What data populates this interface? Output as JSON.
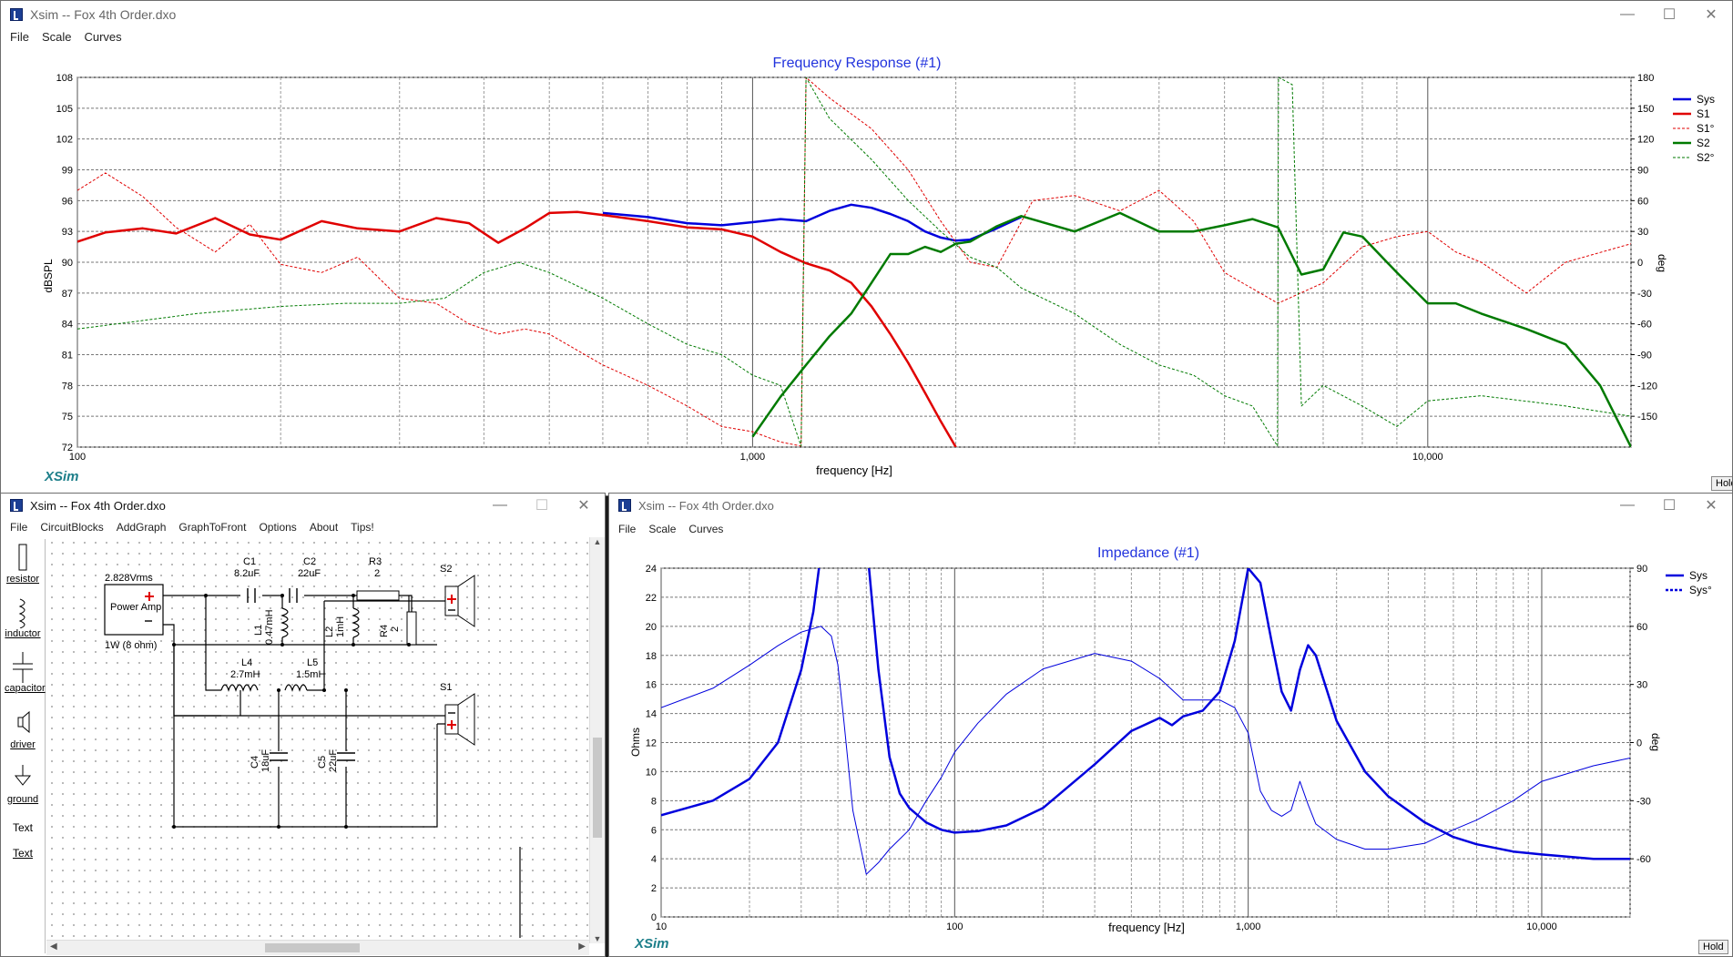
{
  "main_window": {
    "title": "Xsim -- Fox 4th Order.dxo",
    "menu": [
      "File",
      "Scale",
      "Curves"
    ],
    "hold_label": "Hold",
    "brand": "XSim"
  },
  "fr_chart": {
    "title": "Frequency Response (#1)",
    "xlabel": "frequency [Hz]",
    "ylabel": "dBSPL",
    "y2label": "deg",
    "x_ticks": [
      "100",
      "1,000",
      "10,000"
    ],
    "y_ticks": [
      "108",
      "105",
      "102",
      "99",
      "96",
      "93",
      "90",
      "87",
      "84",
      "81",
      "78",
      "75",
      "72"
    ],
    "y2_ticks": [
      "180",
      "150",
      "120",
      "90",
      "60",
      "30",
      "0",
      "-30",
      "-60",
      "-90",
      "-120",
      "-150"
    ],
    "legend": [
      "Sys",
      "S1",
      "S1°",
      "S2",
      "S2°"
    ],
    "colors": {
      "sys": "#0000dd",
      "s1": "#e00000",
      "s2": "#007a00"
    }
  },
  "chart_data": [
    {
      "type": "line",
      "title": "Frequency Response (#1)",
      "xlabel": "frequency [Hz]",
      "ylabel": "dBSPL",
      "y2label": "deg",
      "xscale": "log",
      "xlim": [
        100,
        20000
      ],
      "ylim": [
        72,
        108
      ],
      "y2lim": [
        -180,
        180
      ],
      "grid": true,
      "legend": "right",
      "series": [
        {
          "name": "Sys",
          "axis": "left",
          "style": "solid",
          "color": "#0000dd",
          "x": [
            600,
            700,
            800,
            900,
            1000,
            1100,
            1200,
            1300,
            1400,
            1500,
            1600,
            1700,
            1800,
            1900,
            2000,
            2100,
            2300,
            2500
          ],
          "y": [
            94.8,
            94.4,
            93.8,
            93.6,
            93.9,
            94.2,
            94.0,
            95.0,
            95.6,
            95.3,
            94.7,
            94.0,
            93.0,
            92.4,
            92.1,
            92.2,
            93.3,
            94.4
          ]
        },
        {
          "name": "S1",
          "axis": "left",
          "style": "solid",
          "color": "#e00000",
          "x": [
            100,
            110,
            125,
            140,
            160,
            180,
            200,
            230,
            260,
            300,
            340,
            380,
            420,
            460,
            500,
            550,
            600,
            700,
            800,
            900,
            1000,
            1100,
            1200,
            1300,
            1400,
            1500,
            1600,
            1700,
            1800,
            1900,
            2000
          ],
          "y": [
            92.0,
            92.9,
            93.3,
            92.8,
            94.3,
            92.7,
            92.2,
            94.0,
            93.3,
            93.0,
            94.3,
            93.8,
            91.9,
            93.3,
            94.8,
            94.9,
            94.6,
            94.0,
            93.4,
            93.2,
            92.5,
            91.0,
            89.9,
            89.2,
            88.0,
            85.7,
            83.0,
            80.2,
            77.3,
            74.5,
            72.0
          ]
        },
        {
          "name": "S1°",
          "axis": "right",
          "style": "dashed",
          "color": "#e00000",
          "x": [
            100,
            110,
            125,
            140,
            160,
            180,
            200,
            230,
            260,
            300,
            340,
            380,
            420,
            460,
            500,
            600,
            700,
            800,
            900,
            1000,
            1100,
            1180,
            1200,
            1300,
            1500,
            1700,
            1900,
            2100,
            2300,
            2600,
            3000,
            3500,
            4000,
            4500,
            5000,
            6000,
            7000,
            8000,
            9000,
            10000,
            11000,
            12000,
            14000,
            16000,
            20000
          ],
          "y": [
            70,
            87,
            64,
            34,
            10,
            37,
            -2,
            -10,
            5,
            -35,
            -40,
            -60,
            -70,
            -65,
            -70,
            -100,
            -120,
            -140,
            -160,
            -165,
            -175,
            -179,
            180,
            160,
            130,
            90,
            40,
            0,
            -5,
            60,
            65,
            50,
            70,
            40,
            -10,
            -40,
            -20,
            15,
            25,
            30,
            10,
            0,
            -30,
            0,
            18
          ]
        },
        {
          "name": "S2",
          "axis": "left",
          "style": "solid",
          "color": "#007a00",
          "x": [
            1000,
            1100,
            1200,
            1300,
            1400,
            1500,
            1600,
            1700,
            1800,
            1900,
            2000,
            2100,
            2300,
            2500,
            3000,
            3500,
            4000,
            4500,
            5000,
            5500,
            6000,
            6500,
            7000,
            7500,
            8000,
            9000,
            10000,
            11000,
            12000,
            14000,
            16000,
            18000,
            20000
          ],
          "y": [
            73.0,
            76.9,
            80.0,
            82.8,
            85.0,
            88.0,
            90.8,
            90.8,
            91.5,
            91.0,
            91.8,
            92.0,
            93.5,
            94.5,
            93.0,
            94.8,
            93.0,
            93.0,
            93.6,
            94.2,
            93.4,
            88.8,
            89.3,
            92.9,
            92.5,
            89.0,
            86.0,
            86.0,
            85.0,
            83.5,
            82.0,
            78.0,
            72.0
          ]
        },
        {
          "name": "S2°",
          "axis": "right",
          "style": "dashed",
          "color": "#007a00",
          "x": [
            100,
            150,
            200,
            250,
            300,
            350,
            400,
            450,
            500,
            600,
            700,
            800,
            900,
            1000,
            1100,
            1180,
            1200,
            1300,
            1500,
            1700,
            1900,
            2100,
            2300,
            2500,
            3000,
            3500,
            4000,
            4500,
            5000,
            5500,
            5990,
            6010,
            6300,
            6500,
            7000,
            8000,
            9000,
            10000,
            12000,
            16000,
            20000
          ],
          "y": [
            -65,
            -50,
            -43,
            -40,
            -40,
            -35,
            -10,
            0,
            -10,
            -35,
            -60,
            -80,
            -90,
            -110,
            -120,
            -179,
            180,
            140,
            100,
            60,
            30,
            5,
            -5,
            -25,
            -50,
            -80,
            -100,
            -110,
            -130,
            -140,
            -179,
            180,
            173,
            -140,
            -120,
            -140,
            -160,
            -135,
            -130,
            -140,
            -150
          ]
        }
      ]
    },
    {
      "type": "line",
      "title": "Impedance (#1)",
      "xlabel": "frequency [Hz]",
      "ylabel": "Ohms",
      "y2label": "deg",
      "xscale": "log",
      "xlim": [
        10,
        20000
      ],
      "ylim": [
        0,
        24
      ],
      "y2lim": [
        -90,
        90
      ],
      "grid": true,
      "legend": "right",
      "series": [
        {
          "name": "Sys",
          "axis": "left",
          "style": "solid",
          "color": "#0000dd",
          "x": [
            10,
            15,
            20,
            25,
            30,
            33,
            35,
            40,
            45,
            50,
            55,
            60,
            65,
            70,
            80,
            90,
            100,
            120,
            150,
            200,
            300,
            400,
            500,
            550,
            600,
            700,
            800,
            900,
            1000,
            1100,
            1200,
            1300,
            1400,
            1500,
            1600,
            1700,
            2000,
            2500,
            3000,
            4000,
            5000,
            6000,
            8000,
            10000,
            15000,
            20000
          ],
          "y": [
            7.0,
            8.0,
            9.5,
            12.0,
            17.0,
            21.0,
            25.0,
            30.0,
            30.0,
            26.0,
            17.0,
            11.0,
            8.5,
            7.5,
            6.5,
            6.0,
            5.8,
            5.9,
            6.3,
            7.5,
            10.5,
            12.8,
            13.7,
            13.2,
            13.8,
            14.2,
            15.5,
            19.0,
            24.0,
            23.0,
            19.0,
            15.5,
            14.2,
            17.0,
            18.7,
            18.0,
            13.5,
            10.0,
            8.3,
            6.5,
            5.5,
            5.0,
            4.5,
            4.3,
            4.0,
            4.0
          ]
        },
        {
          "name": "Sys°",
          "axis": "right",
          "style": "solid",
          "color": "#0000dd",
          "x": [
            10,
            15,
            20,
            25,
            30,
            35,
            38,
            40,
            42,
            45,
            50,
            55,
            60,
            70,
            80,
            90,
            100,
            120,
            150,
            200,
            300,
            400,
            500,
            600,
            700,
            800,
            900,
            1000,
            1100,
            1200,
            1300,
            1400,
            1500,
            1600,
            1700,
            2000,
            2500,
            3000,
            4000,
            5000,
            6000,
            8000,
            10000,
            15000,
            20000
          ],
          "y": [
            18,
            28,
            40,
            50,
            57,
            60,
            55,
            40,
            10,
            -35,
            -68,
            -62,
            -55,
            -45,
            -30,
            -18,
            -5,
            10,
            25,
            38,
            46,
            42,
            33,
            22,
            22,
            22,
            18,
            5,
            -25,
            -35,
            -38,
            -35,
            -20,
            -32,
            -42,
            -50,
            -55,
            -55,
            -52,
            -45,
            -40,
            -30,
            -20,
            -12,
            -8
          ]
        }
      ]
    }
  ],
  "circuit_window": {
    "title": "Xsim -- Fox 4th Order.dxo",
    "menu": [
      "File",
      "CircuitBlocks",
      "AddGraph",
      "GraphToFront",
      "Options",
      "About",
      "Tips!"
    ],
    "toolbox": [
      "resistor",
      "inductor",
      "capacitor",
      "driver",
      "ground",
      "Text",
      "Text"
    ],
    "amp": {
      "voltage": "2.828Vrms",
      "label": "Power Amp",
      "power": "1W (8 ohm)"
    },
    "components": [
      {
        "name": "C1",
        "value": "8.2uF"
      },
      {
        "name": "C2",
        "value": "22uF"
      },
      {
        "name": "R3",
        "value": "2"
      },
      {
        "name": "L1",
        "value": "0.47mH"
      },
      {
        "name": "L2",
        "value": "1mH"
      },
      {
        "name": "R4",
        "value": "2"
      },
      {
        "name": "L4",
        "value": "2.7mH"
      },
      {
        "name": "L5",
        "value": "1.5mH"
      },
      {
        "name": "C4",
        "value": "18uF"
      },
      {
        "name": "C5",
        "value": "22uF"
      }
    ],
    "drivers": [
      "S2",
      "S1"
    ]
  },
  "impedance_window": {
    "title": "Xsim -- Fox 4th Order.dxo",
    "menu": [
      "File",
      "Scale",
      "Curves"
    ],
    "hold_label": "Hold",
    "brand": "XSim"
  },
  "imp_chart": {
    "title": "Impedance (#1)",
    "xlabel": "frequency [Hz]",
    "ylabel": "Ohms",
    "y2label": "deg",
    "x_ticks": [
      "10",
      "100",
      "1,000",
      "10,000"
    ],
    "y_ticks": [
      "24",
      "22",
      "20",
      "18",
      "16",
      "14",
      "12",
      "10",
      "8",
      "6",
      "4",
      "2",
      "0"
    ],
    "y2_ticks": [
      "90",
      "60",
      "30",
      "0",
      "-30",
      "-60"
    ],
    "legend": [
      "Sys",
      "Sys°"
    ],
    "colors": {
      "sys": "#0000dd"
    }
  }
}
